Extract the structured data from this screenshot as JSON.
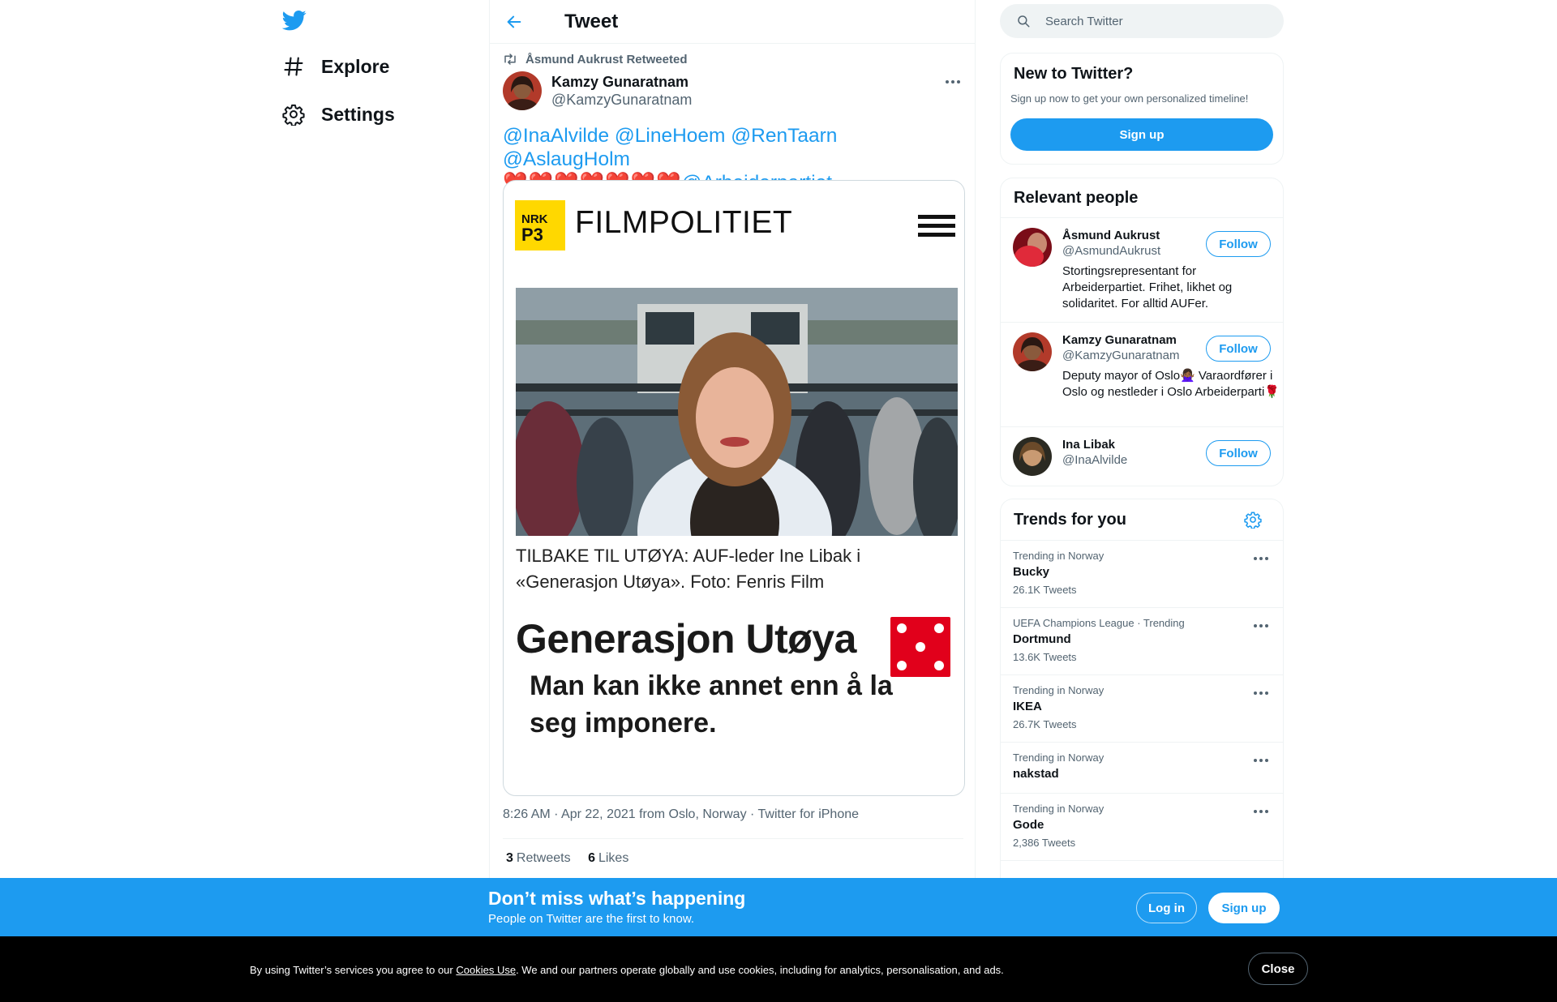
{
  "nav": {
    "logo_icon": "twitter-bird-icon",
    "explore_label": "Explore",
    "settings_label": "Settings"
  },
  "header": {
    "title": "Tweet",
    "back_icon": "arrow-left-icon"
  },
  "tweet": {
    "retweet_label": "Åsmund Aukrust Retweeted",
    "author_name": "Kamzy Gunaratnam",
    "author_handle": "@KamzyGunaratnam",
    "mentions_line1": "@InaAlvilde @LineHoem @RenTaarn @AslaugHolm",
    "hearts": "❤️❤️❤️❤️❤️❤️❤️",
    "mention_party": "@Arbeiderpartiet",
    "media": {
      "site_title": "FILMPOLITIET",
      "logo_text": "NRK P3",
      "caption": "TILBAKE TIL UTØYA: AUF-leder Ine Libak i «Generasjon Utøya». Foto: Fenris Film",
      "movie_title": "Generasjon Utøya",
      "quote": "Man kan ikke annet enn å la seg imponere."
    },
    "meta": "8:26 AM · Apr 22, 2021 from Oslo, Norway · Twitter for iPhone",
    "retweets_count": "3",
    "retweets_label": "Retweets",
    "likes_count": "6",
    "likes_label": "Likes"
  },
  "search": {
    "placeholder": "Search Twitter"
  },
  "new_to_twitter": {
    "title": "New to Twitter?",
    "subtitle": "Sign up now to get your own personalized timeline!",
    "signup_label": "Sign up"
  },
  "relevant_people": {
    "title": "Relevant people",
    "people": [
      {
        "name": "Åsmund Aukrust",
        "handle": "@AsmundAukrust",
        "bio": "Stortingsrepresentant for Arbeiderpartiet. Frihet, likhet og solidaritet. For alltid AUFer.",
        "follow_label": "Follow"
      },
      {
        "name": "Kamzy Gunaratnam",
        "handle": "@KamzyGunaratnam",
        "bio": "Deputy mayor of Oslo🙅🏾‍♀️ Varaordfører i Oslo og nestleder i Oslo Arbeiderparti🌹",
        "follow_label": "Follow"
      },
      {
        "name": "Ina Libak",
        "handle": "@InaAlvilde",
        "bio": "",
        "follow_label": "Follow"
      }
    ]
  },
  "trends": {
    "title": "Trends for you",
    "items": [
      {
        "meta": "Trending in Norway",
        "name": "Bucky",
        "count": "26.1K Tweets"
      },
      {
        "meta": "UEFA Champions League · Trending",
        "name": "Dortmund",
        "count": "13.6K Tweets"
      },
      {
        "meta": "Trending in Norway",
        "name": "IKEA",
        "count": "26.7K Tweets"
      },
      {
        "meta": "Trending in Norway",
        "name": "nakstad",
        "count": ""
      },
      {
        "meta": "Trending in Norway",
        "name": "Gode",
        "count": "2,386 Tweets"
      }
    ]
  },
  "bottom_bar": {
    "title": "Don’t miss what’s happening",
    "subtitle": "People on Twitter are the first to know.",
    "login_label": "Log in",
    "signup_label": "Sign up"
  },
  "cookie_bar": {
    "text_before": "By using Twitter’s services you agree to our ",
    "link_label": "Cookies Use",
    "text_after": ". We and our partners operate globally and use cookies, including for analytics, personalisation, and ads.",
    "close_label": "Close"
  },
  "colors": {
    "accent": "#1d9bf0",
    "heart": "#e0245e",
    "muted": "#536471"
  }
}
